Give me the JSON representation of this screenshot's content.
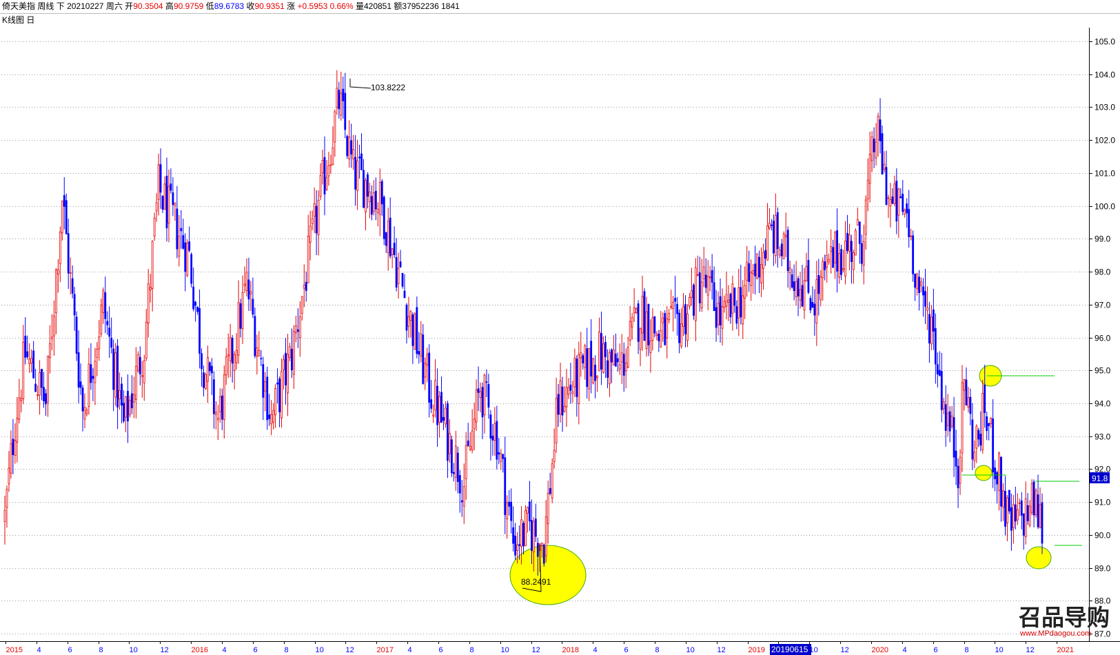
{
  "info": {
    "name": "倚天美指",
    "period": "周线",
    "direction": "下",
    "date": "20210227",
    "weekday": "周六",
    "open_label": "开",
    "open": "90.3504",
    "high_label": "高",
    "high": "90.9759",
    "low_label": "低",
    "low": "89.6783",
    "close_label": "收",
    "close": "90.9351",
    "change_label": "涨",
    "change": "+0.5953",
    "change_pct": "0.66%",
    "volume_label": "量",
    "volume": "420851",
    "amount_label": "额",
    "amount": "37952236",
    "count": "1841"
  },
  "chart_title": "K线图 日",
  "current_price_label": "91.8",
  "annotations": {
    "high": "103.8222",
    "low": "88.2491",
    "selected_date": "20190615"
  },
  "watermark": {
    "text": "召品导购",
    "url": "www.MPdaogou.com"
  },
  "colors": {
    "up": "#e60000",
    "down": "#0000ff",
    "highlight": "#ffff00",
    "level_line": "#00cc00",
    "grid": "#999999"
  },
  "chart_data": {
    "type": "candlestick",
    "title": "",
    "y_ticks": [
      "87.0",
      "88.0",
      "89.0",
      "90.0",
      "91.0",
      "92.0",
      "93.0",
      "94.0",
      "95.0",
      "96.0",
      "97.0",
      "98.0",
      "99.0",
      "100.0",
      "101.0",
      "102.0",
      "103.0",
      "104.0",
      "105.0"
    ],
    "ylim": [
      87.0,
      105.5
    ],
    "x_ticks": [
      {
        "label": "2015",
        "type": "year"
      },
      {
        "label": "4",
        "type": "month"
      },
      {
        "label": "6",
        "type": "month"
      },
      {
        "label": "8",
        "type": "month"
      },
      {
        "label": "10",
        "type": "month"
      },
      {
        "label": "12",
        "type": "month"
      },
      {
        "label": "2016",
        "type": "year"
      },
      {
        "label": "4",
        "type": "month"
      },
      {
        "label": "6",
        "type": "month"
      },
      {
        "label": "8",
        "type": "month"
      },
      {
        "label": "10",
        "type": "month"
      },
      {
        "label": "12",
        "type": "month"
      },
      {
        "label": "2017",
        "type": "year"
      },
      {
        "label": "4",
        "type": "month"
      },
      {
        "label": "6",
        "type": "month"
      },
      {
        "label": "8",
        "type": "month"
      },
      {
        "label": "10",
        "type": "month"
      },
      {
        "label": "12",
        "type": "month"
      },
      {
        "label": "2018",
        "type": "year"
      },
      {
        "label": "4",
        "type": "month"
      },
      {
        "label": "6",
        "type": "month"
      },
      {
        "label": "8",
        "type": "month"
      },
      {
        "label": "10",
        "type": "month"
      },
      {
        "label": "12",
        "type": "month"
      },
      {
        "label": "2019",
        "type": "year"
      },
      {
        "label": "4",
        "type": "month"
      },
      {
        "label": "10",
        "type": "month"
      },
      {
        "label": "12",
        "type": "month"
      },
      {
        "label": "2020",
        "type": "year"
      },
      {
        "label": "4",
        "type": "month"
      },
      {
        "label": "6",
        "type": "month"
      },
      {
        "label": "8",
        "type": "month"
      },
      {
        "label": "10",
        "type": "month"
      },
      {
        "label": "12",
        "type": "month"
      },
      {
        "label": "2021",
        "type": "year"
      }
    ],
    "anchors": [
      [
        0,
        90.5
      ],
      [
        5,
        93.5
      ],
      [
        10,
        95.5
      ],
      [
        20,
        94.0
      ],
      [
        28,
        100.3
      ],
      [
        38,
        93.8
      ],
      [
        48,
        97.0
      ],
      [
        58,
        93.3
      ],
      [
        68,
        95.8
      ],
      [
        75,
        100.5
      ],
      [
        90,
        98.5
      ],
      [
        96,
        95.5
      ],
      [
        104,
        93.5
      ],
      [
        118,
        97.6
      ],
      [
        130,
        93.5
      ],
      [
        140,
        95.5
      ],
      [
        150,
        99.0
      ],
      [
        163,
        103.2
      ],
      [
        170,
        101.0
      ],
      [
        178,
        100.6
      ],
      [
        184,
        100.0
      ],
      [
        190,
        98.5
      ],
      [
        198,
        96.5
      ],
      [
        207,
        94.5
      ],
      [
        216,
        93.0
      ],
      [
        224,
        91.6
      ],
      [
        232,
        94.5
      ],
      [
        240,
        93.0
      ],
      [
        248,
        89.8
      ],
      [
        256,
        90.2
      ],
      [
        263,
        89.8
      ],
      [
        270,
        94.0
      ],
      [
        280,
        94.8
      ],
      [
        290,
        95.5
      ],
      [
        300,
        95.0
      ],
      [
        310,
        96.8
      ],
      [
        320,
        96.0
      ],
      [
        330,
        96.5
      ],
      [
        340,
        97.8
      ],
      [
        350,
        96.5
      ],
      [
        362,
        97.5
      ],
      [
        374,
        99.2
      ],
      [
        385,
        98.0
      ],
      [
        395,
        97.2
      ],
      [
        405,
        98.5
      ],
      [
        418,
        99.0
      ],
      [
        425,
        102.3
      ],
      [
        432,
        100.0
      ],
      [
        440,
        99.8
      ],
      [
        447,
        97.0
      ],
      [
        452,
        96.5
      ],
      [
        458,
        94.0
      ],
      [
        465,
        92.2
      ],
      [
        468,
        94.7
      ],
      [
        473,
        92.5
      ],
      [
        478,
        93.8
      ],
      [
        484,
        92.0
      ],
      [
        490,
        90.2
      ],
      [
        496,
        90.5
      ],
      [
        502,
        91.0
      ],
      [
        506,
        90.3
      ]
    ],
    "n_bars": 507
  }
}
